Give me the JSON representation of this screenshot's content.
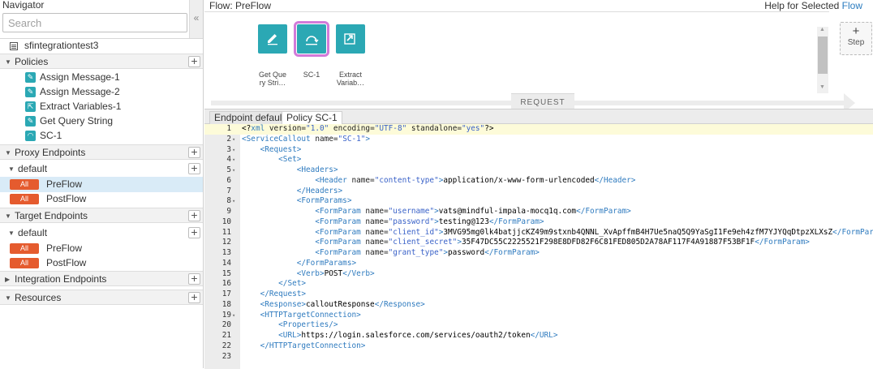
{
  "navigator": {
    "title": "Navigator",
    "search_placeholder": "Search",
    "collapse_glyph": "«",
    "proxy_name": "sfintegrationtest3",
    "sections": {
      "policies": "Policies",
      "proxy_endpoints": "Proxy Endpoints",
      "target_endpoints": "Target Endpoints",
      "integration_endpoints": "Integration Endpoints",
      "resources": "Resources"
    },
    "policies": [
      {
        "label": "Assign Message-1",
        "icon": "edit-icon"
      },
      {
        "label": "Assign Message-2",
        "icon": "edit-icon"
      },
      {
        "label": "Extract Variables-1",
        "icon": "extract-icon"
      },
      {
        "label": "Get Query String",
        "icon": "edit-icon"
      },
      {
        "label": "SC-1",
        "icon": "service-callout-icon"
      }
    ],
    "proxy_default": "default",
    "proxy_flows": [
      {
        "badge": "All",
        "label": "PreFlow"
      },
      {
        "badge": "All",
        "label": "PostFlow"
      }
    ],
    "target_default": "default",
    "target_flows": [
      {
        "badge": "All",
        "label": "PreFlow"
      },
      {
        "badge": "All",
        "label": "PostFlow"
      }
    ]
  },
  "flow": {
    "title": "Flow: PreFlow",
    "help_prefix": "Help for Selected",
    "help_link": "Flow",
    "policies": [
      {
        "line1": "Get Que",
        "line2": "ry Stri…"
      },
      {
        "line1": "SC-1",
        "line2": ""
      },
      {
        "line1": "Extract",
        "line2": "Variab…"
      }
    ],
    "request_label": "REQUEST",
    "step_plus": "+",
    "step_label": "Step"
  },
  "editor": {
    "tabs": [
      "Endpoint default",
      "Policy SC-1"
    ]
  },
  "colors": {
    "policy_teal": "#2ba8b4",
    "badge_orange": "#e55b2e",
    "selected_outline": "#d27ad9",
    "selected_row": "#d9ebf7",
    "link_blue": "#2a7bbf"
  }
}
